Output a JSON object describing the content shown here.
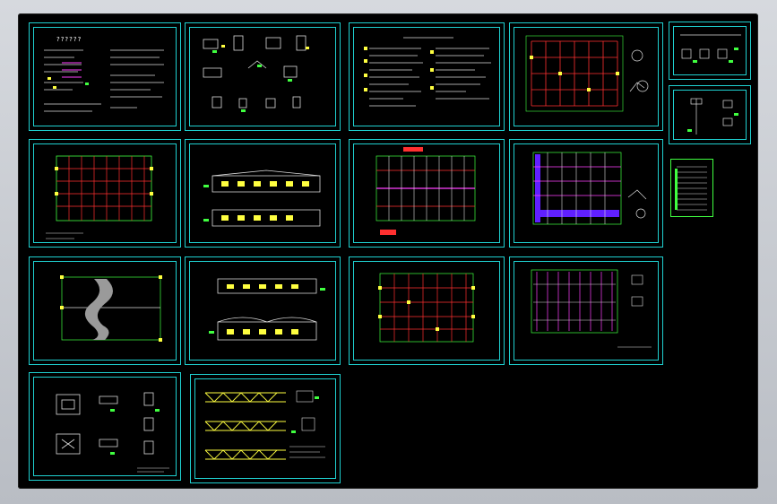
{
  "window": {
    "background": "#000000",
    "frame_color": "#1fd0d0"
  },
  "sheets": [
    {
      "id": "notes",
      "kind": "notes",
      "title": "??????"
    },
    {
      "id": "details-a",
      "kind": "details"
    },
    {
      "id": "spec-list",
      "kind": "spec"
    },
    {
      "id": "plan-1",
      "kind": "grid-plan"
    },
    {
      "id": "small-1",
      "kind": "small-detail"
    },
    {
      "id": "small-2",
      "kind": "small-detail"
    },
    {
      "id": "column-plan",
      "kind": "grid-plan"
    },
    {
      "id": "elevation-1",
      "kind": "elevation"
    },
    {
      "id": "roof-plan",
      "kind": "grid-plan"
    },
    {
      "id": "bracing-plan",
      "kind": "grid-plan"
    },
    {
      "id": "index-sheet",
      "kind": "index"
    },
    {
      "id": "foundation-plan",
      "kind": "foundation"
    },
    {
      "id": "elevation-2",
      "kind": "elevation"
    },
    {
      "id": "purlin-plan",
      "kind": "grid-plan"
    },
    {
      "id": "wall-plan",
      "kind": "grid-plan"
    },
    {
      "id": "footing-details",
      "kind": "details"
    },
    {
      "id": "truss-details",
      "kind": "truss"
    }
  ],
  "colors": {
    "cyan": "#1fd0d0",
    "red": "#ff3030",
    "yellow": "#ffff40",
    "green": "#40ff40",
    "magenta": "#ff40ff",
    "white": "#ffffff",
    "grey": "#9a9a9a"
  }
}
